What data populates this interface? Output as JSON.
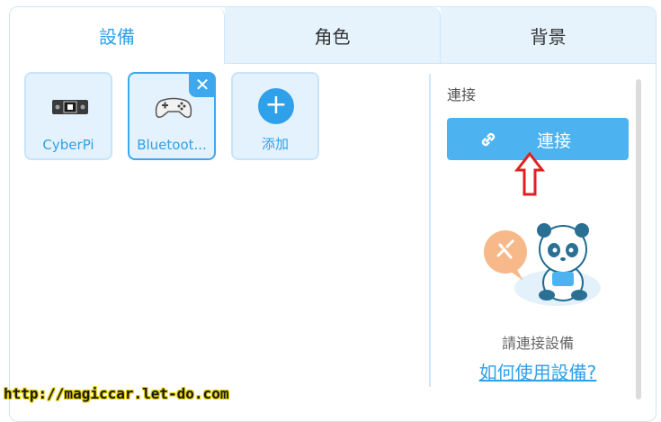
{
  "tabs": [
    {
      "label": "設備",
      "active": true
    },
    {
      "label": "角色",
      "active": false
    },
    {
      "label": "背景",
      "active": false
    }
  ],
  "devices": [
    {
      "label": "CyberPi",
      "icon": "cyberpi-board-icon",
      "selected": false
    },
    {
      "label": "Bluetoot...",
      "icon": "gamepad-icon",
      "selected": true,
      "close_label": "✕"
    }
  ],
  "add_card": {
    "label": "添加",
    "icon_glyph": "+"
  },
  "connect": {
    "heading": "連接",
    "button_label": "連接",
    "hint": "請連接設備",
    "help_link": "如何使用設備?"
  },
  "watermark": "http://magiccar.let-do.com",
  "colors": {
    "accent": "#2fa0ea",
    "button": "#4cb3f0",
    "tab_bg": "#e6f3fd",
    "card_bg": "#e4f2fd",
    "annotation": "#e02020"
  }
}
